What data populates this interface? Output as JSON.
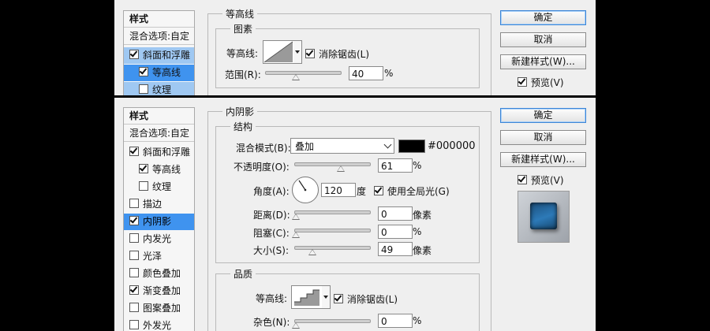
{
  "top": {
    "styles_header": "样式",
    "blend_options": "混合选项:自定",
    "items": [
      {
        "label": "斜面和浮雕",
        "checked": true
      },
      {
        "label": "等高线",
        "checked": true
      },
      {
        "label": "纹理",
        "checked": false
      }
    ],
    "section_title": "等高线",
    "group_title": "图素",
    "contour_label": "等高线:",
    "antialias_label": "消除锯齿(L)",
    "range_label": "范围(R):",
    "range_value": "40",
    "range_unit": "%",
    "ok": "确定",
    "cancel": "取消",
    "new_style": "新建样式(W)...",
    "preview": "预览(V)"
  },
  "bottom": {
    "styles_header": "样式",
    "blend_options": "混合选项:自定",
    "items": [
      {
        "label": "斜面和浮雕",
        "checked": true
      },
      {
        "label": "等高线",
        "checked": true
      },
      {
        "label": "纹理",
        "checked": false
      },
      {
        "label": "描边",
        "checked": false
      },
      {
        "label": "内阴影",
        "checked": true
      },
      {
        "label": "内发光",
        "checked": false
      },
      {
        "label": "光泽",
        "checked": false
      },
      {
        "label": "颜色叠加",
        "checked": false
      },
      {
        "label": "渐变叠加",
        "checked": true
      },
      {
        "label": "图案叠加",
        "checked": false
      },
      {
        "label": "外发光",
        "checked": false
      }
    ],
    "section_title": "内阴影",
    "structure_title": "结构",
    "blend_mode_label": "混合模式(B):",
    "blend_mode_value": "叠加",
    "color_hex": "#000000",
    "opacity_label": "不透明度(O):",
    "opacity_value": "61",
    "opacity_unit": "%",
    "angle_label": "角度(A):",
    "angle_value": "120",
    "angle_unit": "度",
    "global_light_label": "使用全局光(G)",
    "distance_label": "距离(D):",
    "distance_value": "0",
    "distance_unit": "像素",
    "choke_label": "阻塞(C):",
    "choke_value": "0",
    "choke_unit": "%",
    "size_label": "大小(S):",
    "size_value": "49",
    "size_unit": "像素",
    "quality_title": "品质",
    "contour_label": "等高线:",
    "antialias_label": "消除锯齿(L)",
    "noise_label": "杂色(N):",
    "noise_value": "0",
    "noise_unit": "%",
    "ok": "确定",
    "cancel": "取消",
    "new_style": "新建样式(W)...",
    "preview": "预览(V)"
  },
  "colors": {
    "selected": "#3f93ef",
    "swatch": "#000000",
    "preview_tile": "#2a6fa8"
  }
}
